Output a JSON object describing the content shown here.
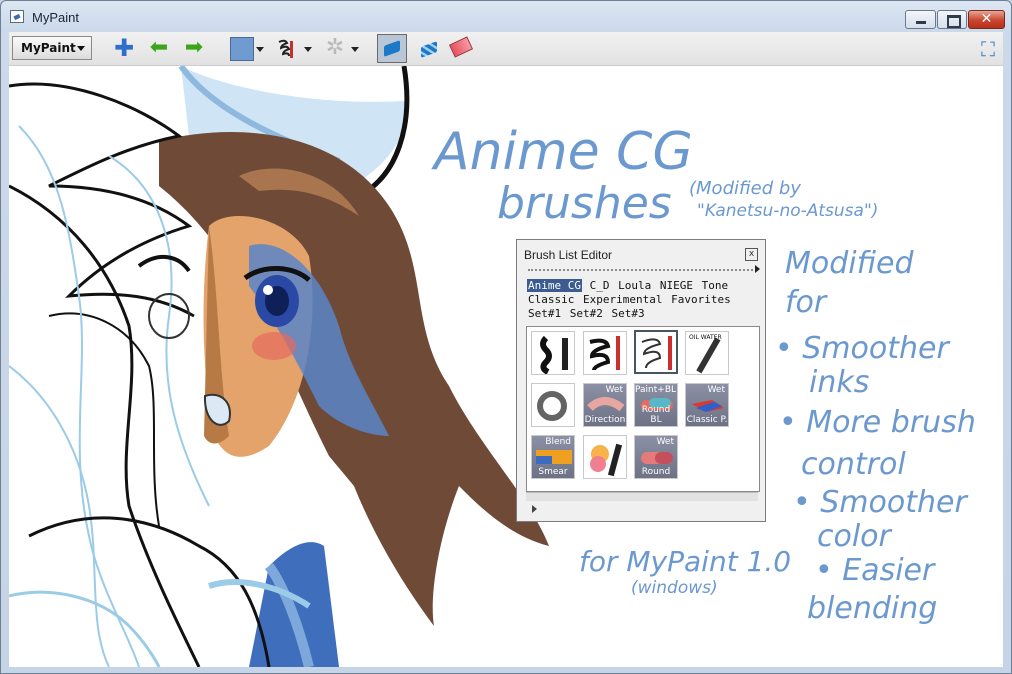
{
  "window": {
    "title": "MyPaint",
    "close_glyph": "✕"
  },
  "toolbar": {
    "menu_label": "MyPaint",
    "icons": [
      "add-layer-icon",
      "undo-icon",
      "redo-icon",
      "color-swatch-icon",
      "brush-icon",
      "settings-icon",
      "paint-mode-icon",
      "fill-mode-icon",
      "eraser-icon",
      "fullscreen-icon"
    ],
    "plus_glyph": "✚",
    "undo_glyph": "⬅",
    "redo_glyph": "➡",
    "settings_glyph": "✲",
    "fullscreen_glyph": "⛶",
    "current_color": "#6f9bd1"
  },
  "canvas": {
    "title_line1": "Anime CG",
    "title_line2": "brushes",
    "credit_line1": "(Modified by",
    "credit_line2": "\"Kanetsu-no-Atsusa\")",
    "features": [
      "Modified",
      "for",
      "• Smoother",
      "inks",
      "• More brush",
      "control",
      "• Smoother",
      "color",
      "• Easier",
      "blending"
    ],
    "footer_line1": "for MyPaint 1.0",
    "footer_line2": "(windows)",
    "ink_color": "#6b99cf"
  },
  "brush_list_editor": {
    "title": "Brush List Editor",
    "close_glyph": "x",
    "groups": [
      "Anime CG",
      "C_D",
      "Loula",
      "NIEGE",
      "Tone",
      "Classic",
      "Experimental",
      "Favorites",
      "Set#1",
      "Set#2",
      "Set#3"
    ],
    "selected_group": "Anime CG",
    "brushes": [
      {
        "label": "",
        "tag": "",
        "id": "ink-pen"
      },
      {
        "label": "",
        "tag": "",
        "id": "ink-brush"
      },
      {
        "label": "",
        "tag": "",
        "id": "sketch-brush"
      },
      {
        "label": "",
        "tag": "OIL WATER",
        "id": "oil-water"
      },
      {
        "label": "",
        "tag": "",
        "id": "airbrush"
      },
      {
        "label": "Direction",
        "tag": "Wet",
        "id": "direction"
      },
      {
        "label": "Round BL",
        "tag": "Paint+BL",
        "id": "round-bl"
      },
      {
        "label": "Classic P.",
        "tag": "Wet",
        "id": "classic-p"
      },
      {
        "label": "Smear",
        "tag": "Blend",
        "id": "smear"
      },
      {
        "label": "",
        "tag": "",
        "id": "marker"
      },
      {
        "label": "Round",
        "tag": "Wet",
        "id": "round"
      }
    ]
  }
}
